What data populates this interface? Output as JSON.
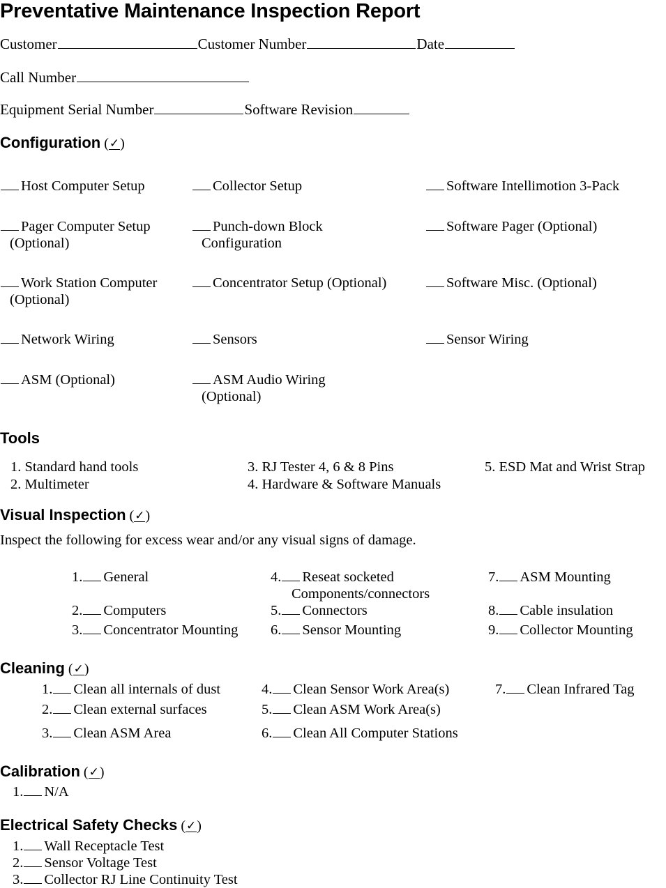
{
  "document": {
    "title": "Preventative Maintenance Inspection Report",
    "checkmark_glyph": "✓"
  },
  "header_fields": {
    "customer_label": "Customer",
    "customer_number_label": "Customer Number",
    "date_label": "Date",
    "call_number_label": "Call Number",
    "equipment_serial_label": "Equipment Serial Number",
    "software_revision_label": "Software Revision"
  },
  "sections": {
    "configuration": {
      "heading": "Configuration",
      "columns": [
        [
          {
            "label": "Host Computer Setup",
            "sub": ""
          },
          {
            "label": "Pager Computer Setup",
            "sub": "(Optional)"
          },
          {
            "label": "Work Station Computer",
            "sub": "(Optional)"
          },
          {
            "label": "Network Wiring",
            "sub": ""
          },
          {
            "label": "ASM (Optional)",
            "sub": ""
          }
        ],
        [
          {
            "label": "Collector Setup",
            "sub": ""
          },
          {
            "label": "Punch-down Block",
            "sub": "Configuration"
          },
          {
            "label": "Concentrator Setup (Optional)",
            "sub": ""
          },
          {
            "label": "Sensors",
            "sub": ""
          },
          {
            "label": "ASM Audio Wiring",
            "sub": "(Optional)"
          }
        ],
        [
          {
            "label": "Software Intellimotion 3-Pack",
            "sub": ""
          },
          {
            "label": "Software Pager (Optional)",
            "sub": ""
          },
          {
            "label": "Software Misc. (Optional)",
            "sub": ""
          },
          {
            "label": "Sensor Wiring",
            "sub": ""
          }
        ]
      ]
    },
    "tools": {
      "heading": "Tools",
      "columns": [
        [
          {
            "num": "1.",
            "label": "Standard hand tools"
          },
          {
            "num": "2.",
            "label": "Multimeter"
          }
        ],
        [
          {
            "num": "3.",
            "label": "RJ Tester 4, 6 & 8 Pins"
          },
          {
            "num": "4.",
            "label": "Hardware & Software Manuals"
          }
        ],
        [
          {
            "num": "5.",
            "label": "ESD Mat and Wrist Strap"
          }
        ]
      ]
    },
    "visual_inspection": {
      "heading": "Visual Inspection",
      "intro": "Inspect the following for excess wear and/or any visual signs of damage.",
      "columns": [
        [
          {
            "num": "1.",
            "label": "General",
            "wrap": ""
          },
          {
            "num": "2.",
            "label": "Computers",
            "wrap": ""
          },
          {
            "num": "3.",
            "label": "Concentrator Mounting",
            "wrap": ""
          }
        ],
        [
          {
            "num": "4.",
            "label": "Reseat socketed",
            "wrap": "Components/connectors"
          },
          {
            "num": "5.",
            "label": "Connectors",
            "wrap": ""
          },
          {
            "num": "6.",
            "label": "Sensor Mounting",
            "wrap": ""
          }
        ],
        [
          {
            "num": "7.",
            "label": "ASM Mounting",
            "wrap": ""
          },
          {
            "num": "8.",
            "label": "Cable insulation",
            "wrap": ""
          },
          {
            "num": "9.",
            "label": "Collector Mounting",
            "wrap": ""
          }
        ]
      ]
    },
    "cleaning": {
      "heading": "Cleaning",
      "columns": [
        [
          {
            "num": "1.",
            "label": "Clean all internals of dust"
          },
          {
            "num": "2.",
            "label": "Clean external surfaces"
          },
          {
            "num": "3.",
            "label": "Clean ASM Area"
          }
        ],
        [
          {
            "num": "4.",
            "label": "Clean Sensor Work Area(s)"
          },
          {
            "num": "5.",
            "label": "Clean ASM Work Area(s)"
          },
          {
            "num": "6.",
            "label": "Clean All Computer Stations"
          }
        ],
        [
          {
            "num": "7.",
            "label": "Clean Infrared Tag"
          }
        ]
      ]
    },
    "calibration": {
      "heading": "Calibration",
      "items": [
        {
          "num": "1.",
          "label": "N/A"
        }
      ]
    },
    "electrical_safety": {
      "heading": "Electrical Safety Checks",
      "items": [
        {
          "num": "1.",
          "label": "Wall Receptacle Test"
        },
        {
          "num": "2.",
          "label": "Sensor Voltage Test"
        },
        {
          "num": "3.",
          "label": "Collector RJ Line Continuity Test"
        }
      ]
    }
  }
}
